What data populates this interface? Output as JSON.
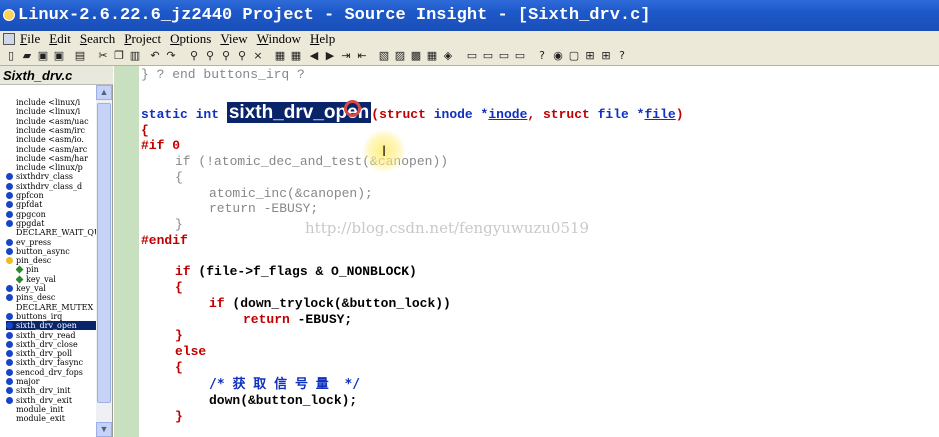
{
  "window": {
    "title": "Linux-2.6.22.6_jz2440 Project - Source Insight - [Sixth_drv.c]"
  },
  "menu": {
    "items": [
      "File",
      "Edit",
      "Search",
      "Project",
      "Options",
      "View",
      "Window",
      "Help"
    ]
  },
  "toolbar": {
    "buttons": [
      {
        "icon": "new-file-icon",
        "glyph": "▯"
      },
      {
        "icon": "open-folder-icon",
        "glyph": "▰"
      },
      {
        "icon": "save-icon",
        "glyph": "▣"
      },
      {
        "icon": "save-all-icon",
        "glyph": "▣"
      },
      {
        "icon": "print-icon",
        "glyph": "▤"
      },
      {
        "icon": "cut-icon",
        "glyph": "✂"
      },
      {
        "icon": "copy-icon",
        "glyph": "❐"
      },
      {
        "icon": "paste-icon",
        "glyph": "▥"
      },
      {
        "icon": "undo-icon",
        "glyph": "↶"
      },
      {
        "icon": "redo-icon",
        "glyph": "↷"
      },
      {
        "icon": "search-icon",
        "glyph": "⚲"
      },
      {
        "icon": "search-files-icon",
        "glyph": "⚲"
      },
      {
        "icon": "find-next-icon",
        "glyph": "⚲"
      },
      {
        "icon": "find-prev-icon",
        "glyph": "⚲"
      },
      {
        "icon": "replace-icon",
        "glyph": "×"
      },
      {
        "icon": "bookmark-icon",
        "glyph": "▦"
      },
      {
        "icon": "bookmark-list-icon",
        "glyph": "▦"
      },
      {
        "icon": "back-icon",
        "glyph": "◀"
      },
      {
        "icon": "forward-icon",
        "glyph": "▶"
      },
      {
        "icon": "jump-icon",
        "glyph": "⇥"
      },
      {
        "icon": "jump-back-icon",
        "glyph": "⇤"
      },
      {
        "icon": "symbol-window-icon",
        "glyph": "▧"
      },
      {
        "icon": "context-window-icon",
        "glyph": "▨"
      },
      {
        "icon": "relation-window-icon",
        "glyph": "▩"
      },
      {
        "icon": "browse-icon",
        "glyph": "▦"
      },
      {
        "icon": "lookup-icon",
        "glyph": "◈"
      },
      {
        "icon": "layout-1-icon",
        "glyph": "▭"
      },
      {
        "icon": "layout-2-icon",
        "glyph": "▭"
      },
      {
        "icon": "layout-3-icon",
        "glyph": "▭"
      },
      {
        "icon": "layout-4-icon",
        "glyph": "▭"
      },
      {
        "icon": "help-icon",
        "glyph": "?"
      },
      {
        "icon": "eye-icon",
        "glyph": "◉"
      },
      {
        "icon": "frame-icon",
        "glyph": "▢"
      },
      {
        "icon": "tree-icon",
        "glyph": "⊞"
      },
      {
        "icon": "tree2-icon",
        "glyph": "⊞"
      },
      {
        "icon": "question-icon",
        "glyph": "?"
      }
    ]
  },
  "sidebar": {
    "file_title": "Sixth_drv.c",
    "symbols": [
      {
        "icon": "include",
        "label": "include <linux/i"
      },
      {
        "icon": "include",
        "label": "include <linux/i"
      },
      {
        "icon": "include",
        "label": "include <asm/uac"
      },
      {
        "icon": "include",
        "label": "include <asm/irc"
      },
      {
        "icon": "include",
        "label": "include <asm/io."
      },
      {
        "icon": "include",
        "label": "include <asm/arc"
      },
      {
        "icon": "include",
        "label": "include <asm/har"
      },
      {
        "icon": "include",
        "label": "include <linux/p"
      },
      {
        "icon": "blue",
        "label": "sixthdrv_class"
      },
      {
        "icon": "blue",
        "label": "sixthdrv_class_d"
      },
      {
        "icon": "blue",
        "label": "gpfcon"
      },
      {
        "icon": "blue",
        "label": "gpfdat"
      },
      {
        "icon": "blue",
        "label": "gpgcon"
      },
      {
        "icon": "blue",
        "label": "gpgdat"
      },
      {
        "icon": "include",
        "label": "DECLARE_WAIT_QUE"
      },
      {
        "icon": "blue",
        "label": "ev_press"
      },
      {
        "icon": "blue",
        "label": "button_async"
      },
      {
        "icon": "yel",
        "label": "pin_desc"
      },
      {
        "icon": "green",
        "label": "pin",
        "indent": true
      },
      {
        "icon": "green",
        "label": "key_val",
        "indent": true
      },
      {
        "icon": "blue",
        "label": "key_val"
      },
      {
        "icon": "blue",
        "label": "pins_desc"
      },
      {
        "icon": "include",
        "label": "DECLARE_MUTEX"
      },
      {
        "icon": "blue",
        "label": "buttons_irq"
      },
      {
        "icon": "blue",
        "label": "sixth_drv_open",
        "selected": true
      },
      {
        "icon": "blue",
        "label": "sixth_drv_read"
      },
      {
        "icon": "blue",
        "label": "sixth_drv_close"
      },
      {
        "icon": "blue",
        "label": "sixth_drv_poll"
      },
      {
        "icon": "blue",
        "label": "sixth_drv_fasync"
      },
      {
        "icon": "blue",
        "label": "sencod_drv_fops"
      },
      {
        "icon": "blue",
        "label": "major"
      },
      {
        "icon": "blue",
        "label": "sixth_drv_init"
      },
      {
        "icon": "blue",
        "label": "sixth_drv_exit"
      },
      {
        "icon": "include",
        "label": "module_init"
      },
      {
        "icon": "include",
        "label": "module_exit"
      }
    ]
  },
  "code": {
    "line_end": "} ? end buttons_irq ?",
    "sig_static": "static",
    "sig_int": "int",
    "sig_name": "sixth_drv_open",
    "sig_open": "(",
    "sig_struct1": "struct",
    "sig_inode_type": "inode",
    "sig_star1": "*",
    "sig_inode": "inode",
    "sig_comma": ",",
    "sig_struct2": "struct",
    "sig_file_type": "file",
    "sig_star2": "*",
    "sig_file": "file",
    "sig_close": ")",
    "brace_open": "{",
    "if0": "#if 0",
    "line_if_gray": "if (!atomic_dec_and_test(&canopen))",
    "line_brace_gray_open": "{",
    "line_atomic": "atomic_inc(&canopen);",
    "line_return_gray": "return -EBUSY;",
    "line_brace_gray_close": "}",
    "endif": "#endif",
    "if_kw": "if",
    "if_cond": "(file->f_flags & O_NONBLOCK)",
    "brace2": "{",
    "if2_kw": "if",
    "if2_cond": "(down_trylock(&button_lock))",
    "ret_kw": "return",
    "ret_val": "-EBUSY;",
    "brace3": "}",
    "else_kw": "else",
    "brace4": "{",
    "comment": "/* 获 取 信 号 量  */",
    "down_call": "down(&button_lock);",
    "brace5": "}"
  },
  "watermark": "http://blog.csdn.net/fengyuwuzu0519"
}
